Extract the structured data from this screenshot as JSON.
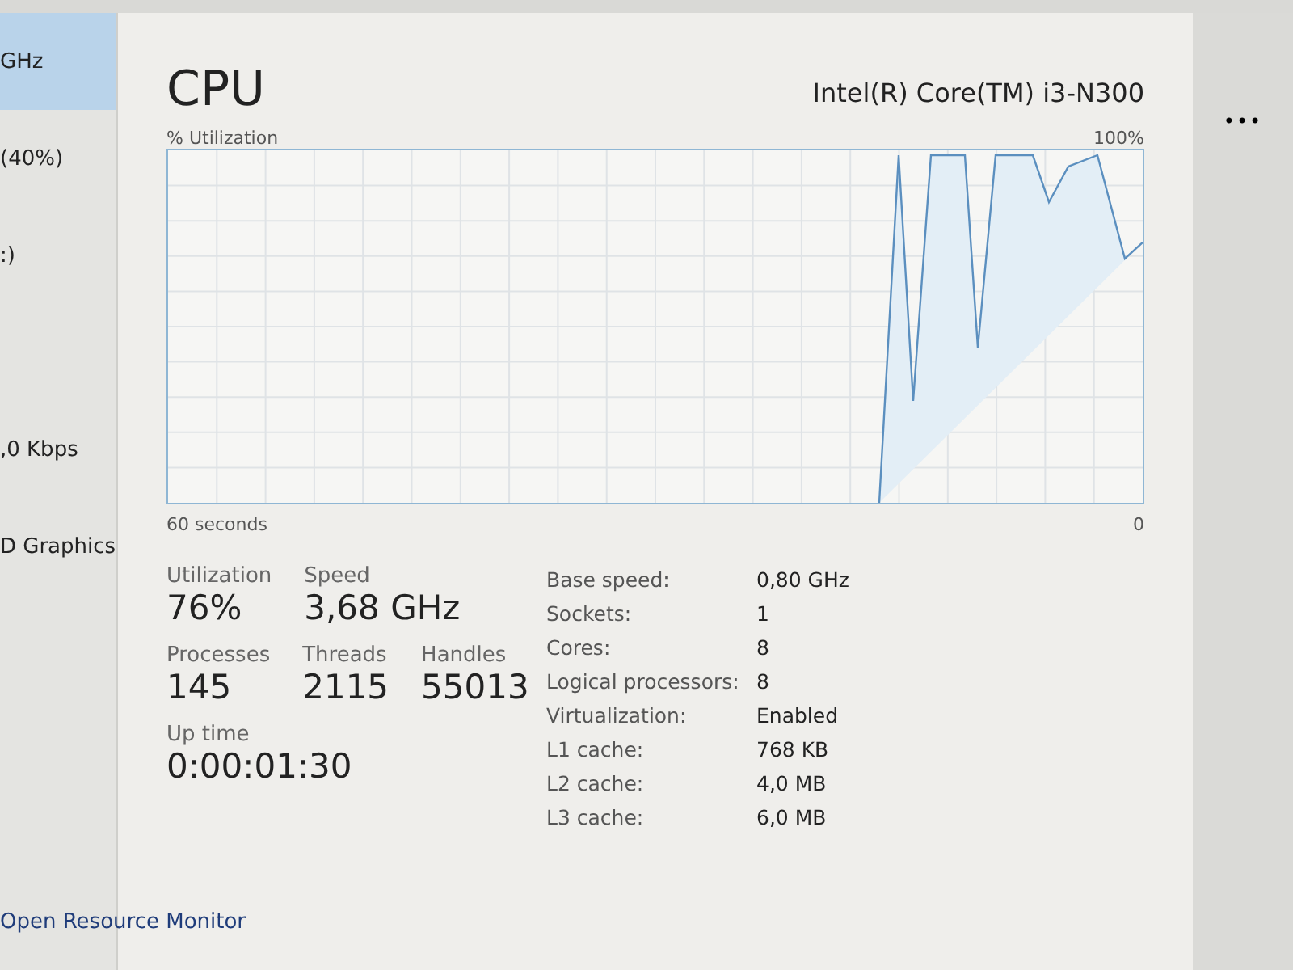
{
  "sidebar": {
    "items": [
      {
        "label": "GHz",
        "selected": true
      },
      {
        "label": "(40%)",
        "selected": false
      },
      {
        "label": ":)",
        "selected": false
      },
      {
        "label": ",0 Kbps",
        "selected": false
      },
      {
        "label": "D Graphics",
        "selected": false
      }
    ]
  },
  "header": {
    "title": "CPU",
    "processor": "Intel(R) Core(TM) i3-N300",
    "more": "•••"
  },
  "graph": {
    "ylabel": "% Utilization",
    "ymax": "100%",
    "xlabel": "60 seconds",
    "ymin": "0"
  },
  "stats": [
    {
      "label": "Utilization",
      "value": "76%"
    },
    {
      "label": "Speed",
      "value": "3,68 GHz"
    }
  ],
  "counts": [
    {
      "label": "Processes",
      "value": "145"
    },
    {
      "label": "Threads",
      "value": "2115"
    },
    {
      "label": "Handles",
      "value": "55013"
    }
  ],
  "uptime": {
    "label": "Up time",
    "value": "0:00:01:30"
  },
  "details": [
    {
      "label": "Base speed:",
      "value": "0,80 GHz"
    },
    {
      "label": "Sockets:",
      "value": "1"
    },
    {
      "label": "Cores:",
      "value": "8"
    },
    {
      "label": "Logical processors:",
      "value": "8"
    },
    {
      "label": "Virtualization:",
      "value": "Enabled"
    },
    {
      "label": "L1 cache:",
      "value": "768 KB"
    },
    {
      "label": "L2 cache:",
      "value": "4,0 MB"
    },
    {
      "label": "L3 cache:",
      "value": "6,0 MB"
    }
  ],
  "footer": {
    "link": "Open Resource Monitor"
  }
}
